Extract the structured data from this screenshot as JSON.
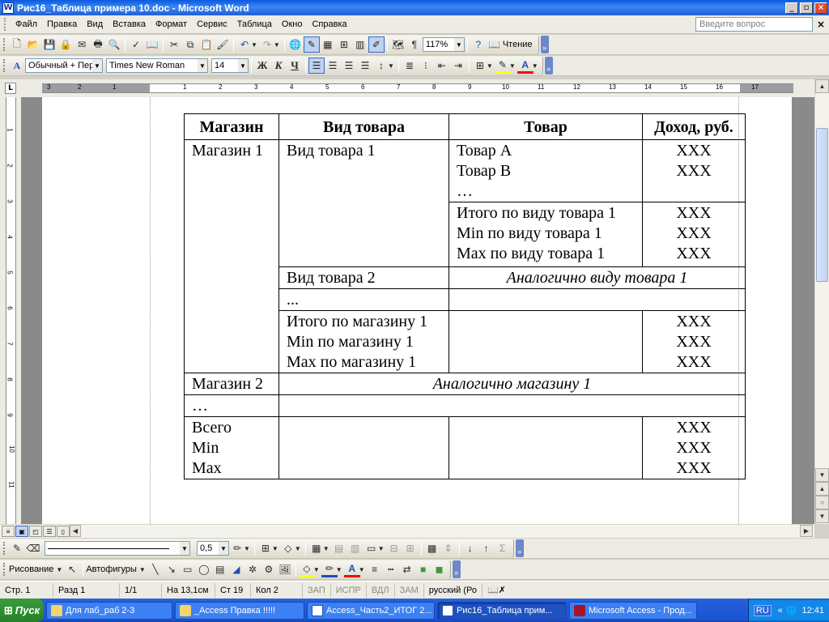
{
  "window": {
    "title": "Рис16_Таблица примера 10.doc - Microsoft Word",
    "buttons": {
      "minimize": "_",
      "restore": "▫",
      "close": "×"
    }
  },
  "menu": {
    "items": [
      "Файл",
      "Правка",
      "Вид",
      "Вставка",
      "Формат",
      "Сервис",
      "Таблица",
      "Окно",
      "Справка"
    ],
    "ask_placeholder": "Введите вопрос",
    "close_doc": "×"
  },
  "standard_toolbar": {
    "zoom": "117%",
    "reading_label": "Чтение"
  },
  "formatting_toolbar": {
    "style": "Обычный + Пер",
    "font": "Times New Roman",
    "size": "14",
    "bold": "Ж",
    "italic": "К",
    "underline": "Ч"
  },
  "ruler": {
    "numbers": [
      "3",
      "2",
      "1",
      "1",
      "2",
      "3",
      "4",
      "5",
      "6",
      "7",
      "8",
      "9",
      "10",
      "11",
      "12",
      "13",
      "14",
      "15",
      "16",
      "17"
    ],
    "vertical_numbers": [
      "1",
      "2",
      "3",
      "4",
      "5",
      "6",
      "7",
      "8",
      "9",
      "10",
      "11"
    ]
  },
  "doc_table": {
    "headers": [
      "Магазин",
      "Вид товара",
      "Товар",
      "Доход, руб."
    ],
    "store1": "Магазин 1",
    "kind1": "Вид товара 1",
    "goods": [
      "Товар А",
      "Товар В",
      "…"
    ],
    "goods_income": [
      "XXX",
      "XXX"
    ],
    "kind_totals": [
      "Итого по виду товара 1",
      "Min по виду товара 1",
      "Max по виду товара 1"
    ],
    "kind_totals_income": [
      "XXX",
      "XXX",
      "XXX"
    ],
    "kind2": "Вид товара 2",
    "kind2_note": "Аналогично виду товара 1",
    "kind_ellipsis": "...",
    "store_totals": [
      "Итого по магазину 1",
      "Min по магазину 1",
      "Max по магазину 1"
    ],
    "store_totals_income": [
      "XXX",
      "XXX",
      "XXX"
    ],
    "store2": "Магазин 2",
    "store2_note": "Аналогично магазину 1",
    "store_ellipsis": "…",
    "grand_totals": [
      "Всего",
      "Min",
      "Max"
    ],
    "grand_totals_income": [
      "XXX",
      "XXX",
      "XXX"
    ]
  },
  "drawing_toolbar": {
    "line_width": "0,5",
    "drawing_label": "Рисование",
    "autoshapes_label": "Автофигуры"
  },
  "status": {
    "page": "Стр. 1",
    "section": "Разд 1",
    "pages": "1/1",
    "at": "На 13,1см",
    "line": "Ст 19",
    "col": "Кол 2",
    "rec": "ЗАП",
    "trk": "ИСПР",
    "ext": "ВДЛ",
    "ovr": "ЗАМ",
    "language": "русский (Ро"
  },
  "taskbar": {
    "start": "Пуск",
    "tasks": [
      "Для лаб_раб 2-3",
      "_Access Правка !!!!!",
      "Access_Часть2_ИТОГ 2...",
      "Рис16_Таблица прим...",
      "Microsoft Access - Прод..."
    ],
    "lang": "RU",
    "time": "12:41"
  },
  "colors": {
    "titlebar": "#0a58e0",
    "toolbar_bg": "#ecebe4",
    "page_bg": "#ffffff",
    "docarea_bg": "#8a8a8a",
    "taskbar": "#245edb",
    "start_button": "#2f8f2f"
  }
}
